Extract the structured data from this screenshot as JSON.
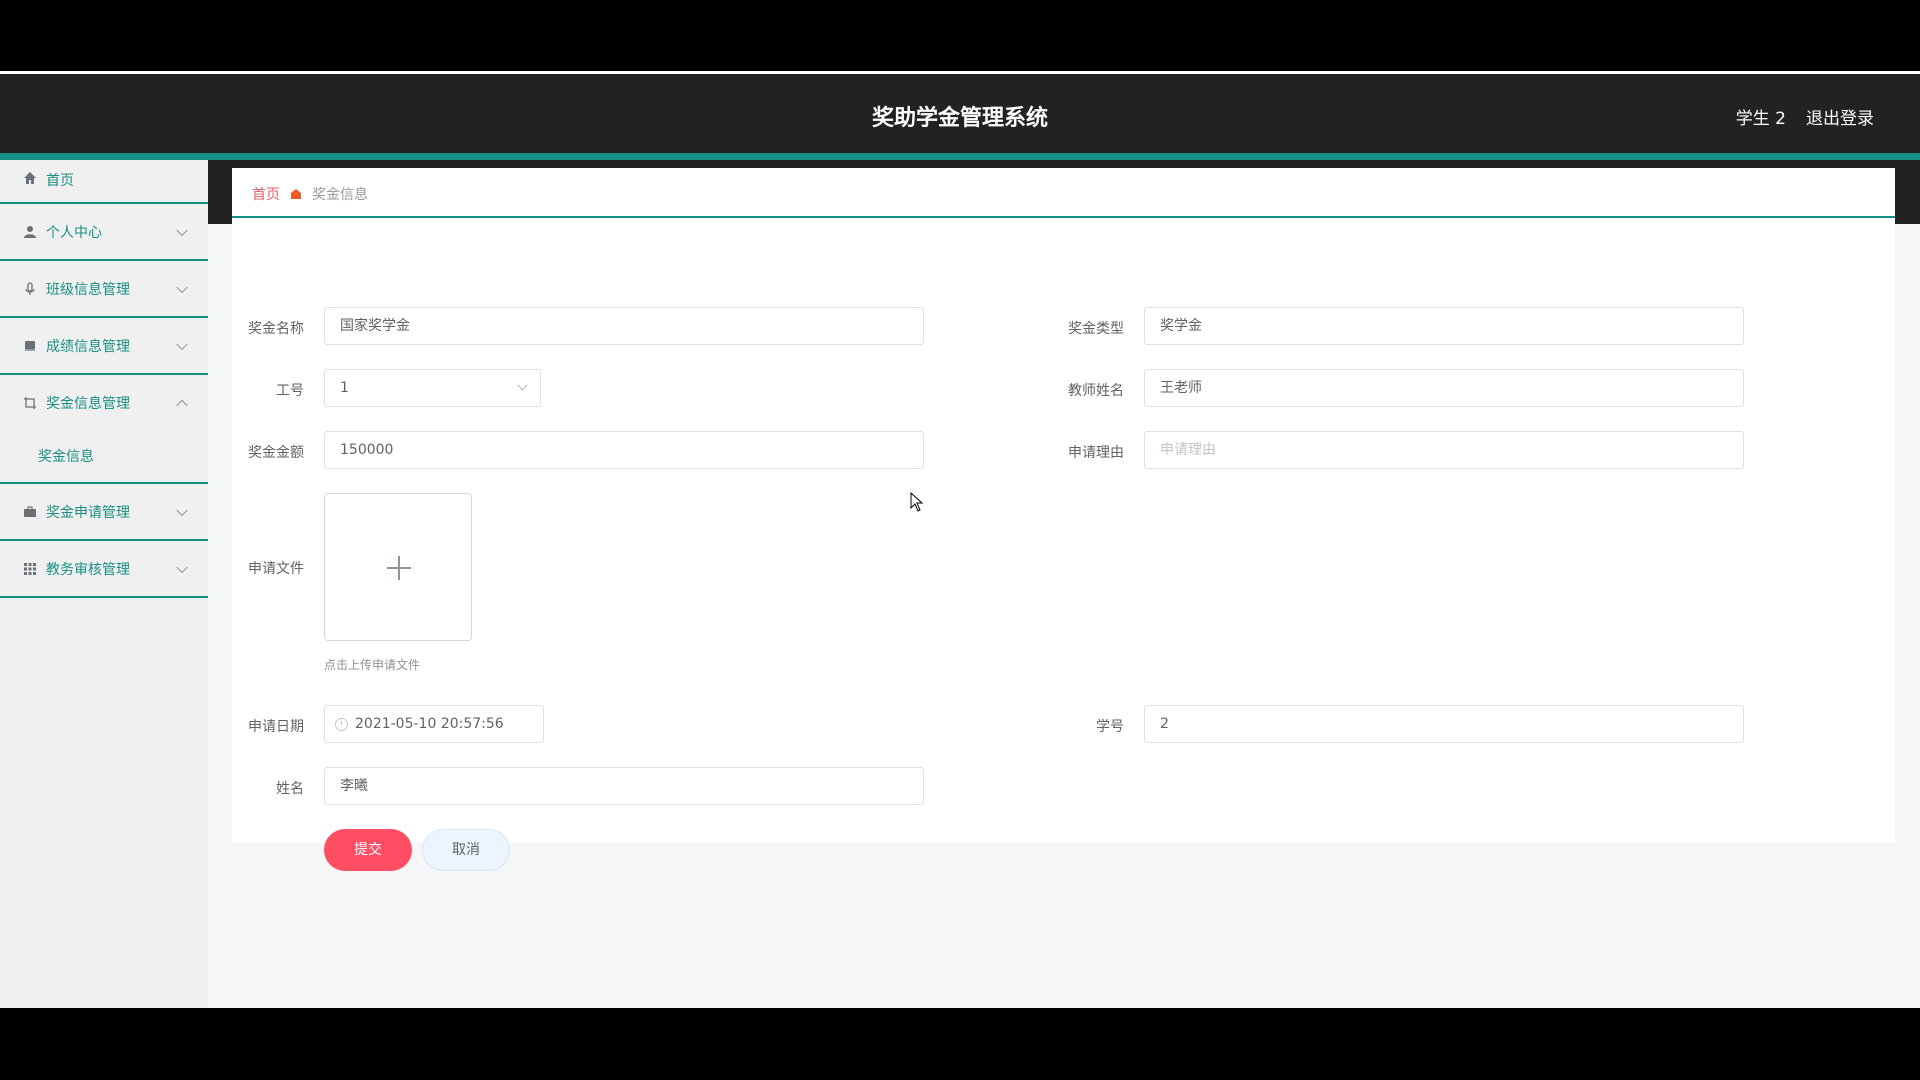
{
  "header": {
    "title": "奖助学金管理系统",
    "user": "学生 2",
    "logout": "退出登录"
  },
  "sidebar": {
    "items": [
      {
        "label": "首页",
        "icon": "home-icon"
      },
      {
        "label": "个人中心",
        "icon": "user-icon"
      },
      {
        "label": "班级信息管理",
        "icon": "microphone-icon"
      },
      {
        "label": "成绩信息管理",
        "icon": "book-icon"
      },
      {
        "label": "奖金信息管理",
        "icon": "crop-icon"
      },
      {
        "label": "奖金申请管理",
        "icon": "briefcase-icon"
      },
      {
        "label": "教务审核管理",
        "icon": "grid-icon"
      }
    ],
    "submenu_label": "奖金信息"
  },
  "breadcrumb": {
    "home": "首页",
    "current": "奖金信息"
  },
  "form": {
    "award_name": {
      "label": "奖金名称",
      "value": "国家奖学金"
    },
    "award_type": {
      "label": "奖金类型",
      "value": "奖学金"
    },
    "job_no": {
      "label": "工号",
      "value": "1"
    },
    "teacher_name": {
      "label": "教师姓名",
      "value": "王老师"
    },
    "amount": {
      "label": "奖金金额",
      "value": "150000"
    },
    "reason": {
      "label": "申请理由",
      "placeholder": "申请理由"
    },
    "file": {
      "label": "申请文件",
      "tip": "点击上传申请文件"
    },
    "date": {
      "label": "申请日期",
      "value": "2021-05-10 20:57:56"
    },
    "student_no": {
      "label": "学号",
      "value": "2"
    },
    "name": {
      "label": "姓名",
      "value": "李曦"
    },
    "submit": "提交",
    "cancel": "取消"
  },
  "colors": {
    "accent": "#178f84",
    "submit": "#ff4d63",
    "header_bg": "#222222"
  }
}
